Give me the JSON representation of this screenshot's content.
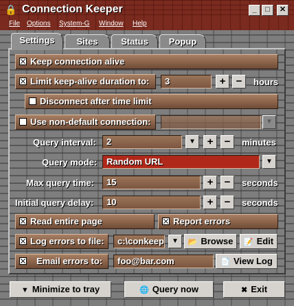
{
  "window": {
    "title": "Connection Keeper",
    "icon": "lock-icon",
    "min": "_",
    "max": "□",
    "close": "✕"
  },
  "menu": [
    "File",
    "Options",
    "System-G",
    "Window",
    "Help"
  ],
  "tabs": [
    "Settings",
    "Sites",
    "Status",
    "Popup"
  ],
  "settings": {
    "keep_alive": {
      "label": "Keep connection alive",
      "checked": true
    },
    "limit_keepalive": {
      "label": "Limit keep-alive duration to:",
      "checked": true,
      "value": "3",
      "unit": "hours"
    },
    "disconnect_after": {
      "label": "Disconnect after time limit",
      "checked": false
    },
    "non_default": {
      "label": "Use non-default connection:",
      "checked": false,
      "value": ""
    },
    "query_interval": {
      "label": "Query interval:",
      "value": "2",
      "unit": "minutes"
    },
    "query_mode": {
      "label": "Query mode:",
      "value": "Random URL"
    },
    "max_query_time": {
      "label": "Max query time:",
      "value": "15",
      "unit": "seconds"
    },
    "initial_delay": {
      "label": "Initial query delay:",
      "value": "10",
      "unit": "seconds"
    },
    "read_entire": {
      "label": "Read entire page",
      "checked": true
    },
    "report_errors": {
      "label": "Report errors",
      "checked": true
    },
    "log_errors": {
      "label": "Log errors to file:",
      "checked": true,
      "value": "c:\\conkeep",
      "browse": "Browse",
      "edit": "Edit"
    },
    "email_errors": {
      "label": "Email errors to:",
      "checked": true,
      "value": "foo@bar.com",
      "view_log": "View Log"
    }
  },
  "bottom": {
    "minimize": "Minimize to tray",
    "query_now": "Query now",
    "exit": "Exit"
  },
  "colors": {
    "brick": "#7d7d7d",
    "wood": "#8a6249",
    "title": "#7a2a1e",
    "query_mode_bg": "#b0281a"
  }
}
